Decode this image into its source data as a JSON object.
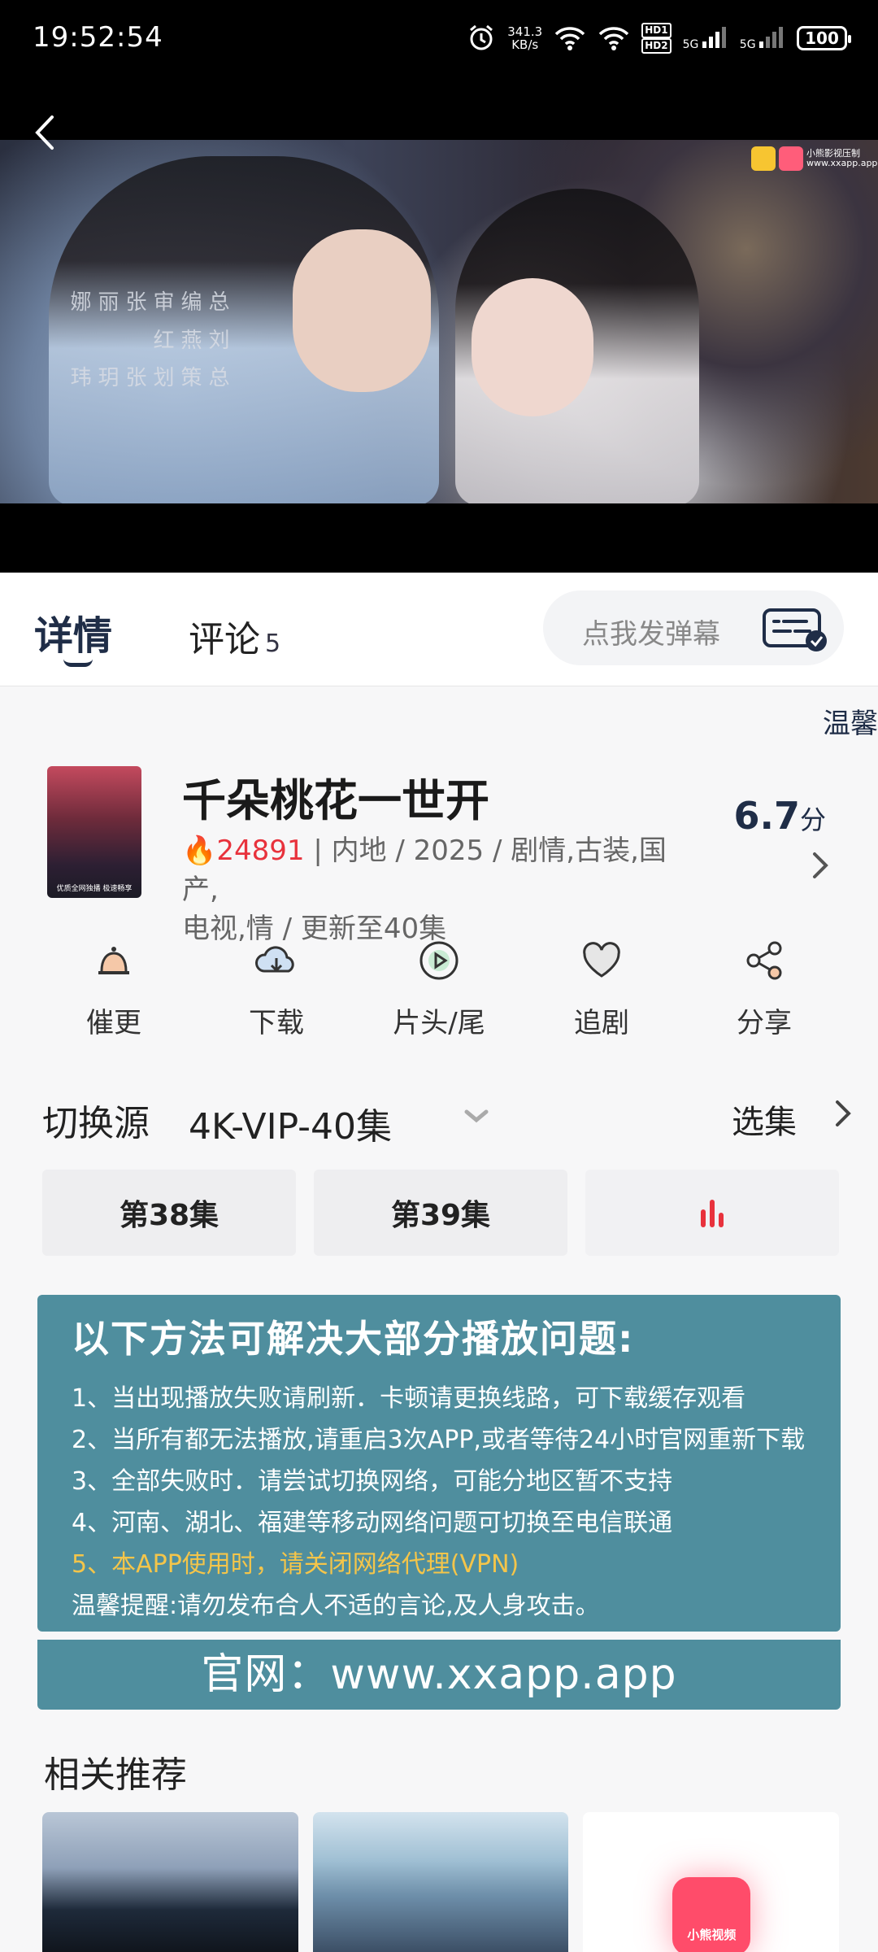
{
  "status_bar": {
    "time": "19:52:54",
    "net_speed_value": "341.3",
    "net_speed_unit": "KB/s",
    "hd1": "HD1",
    "hd2": "HD2",
    "sig1": "5G",
    "sig2": "5G",
    "battery": "100"
  },
  "video": {
    "credits": [
      "总编审 张丽娜",
      "刘燕红",
      "总策划 张玥玮"
    ],
    "watermark": "小熊影视压制 www.xxapp.app"
  },
  "tabs": {
    "detail": "详情",
    "comments": "评论",
    "comments_count": "5",
    "danmaku_placeholder": "点我发弹幕"
  },
  "marquee": "温馨",
  "drama": {
    "title": "千朵桃花一世开",
    "heat": "24891",
    "meta_line1": "| 内地 / 2025 / 剧情,古装,国产,",
    "meta_line2": "电视,情 / 更新至40集",
    "score": "6.7",
    "score_unit": "分",
    "poster_caption": "优质全网独播 极速畅享"
  },
  "actions": [
    {
      "label": "催更",
      "icon": "bell-icon"
    },
    {
      "label": "下载",
      "icon": "cloud-download-icon"
    },
    {
      "label": "片头/尾",
      "icon": "play-circle-icon"
    },
    {
      "label": "追剧",
      "icon": "heart-icon"
    },
    {
      "label": "分享",
      "icon": "share-icon"
    }
  ],
  "source": {
    "label": "切换源",
    "value": "4K-VIP-40集",
    "pick_label": "选集"
  },
  "episodes": [
    "第38集",
    "第39集"
  ],
  "notice": {
    "title": "以下方法可解决大部分播放问题:",
    "lines": [
      "1、当出现播放失败请刷新．卡顿请更换线路，可下载缓存观看",
      "2、当所有都无法播放,请重启3次APP,或者等待24小时官网重新下载",
      "3、全部失败时．请尝试切换网络，可能分地区暂不支持",
      "4、河南、湖北、福建等移动网络问题可切换至电信联通",
      "5、本APP使用时，请关闭网络代理(VPN)",
      "温馨提醒:请勿发布合人不适的言论,及人身攻击。"
    ],
    "site": "官网：www.xxapp.app"
  },
  "recommend": {
    "title": "相关推荐",
    "logo_text": "小熊视频"
  },
  "colors": {
    "accent_dark": "#1f2d47",
    "hot_red": "#e8323c",
    "notice_bg": "#4f8e9e",
    "notice_highlight": "#f4c54a"
  }
}
